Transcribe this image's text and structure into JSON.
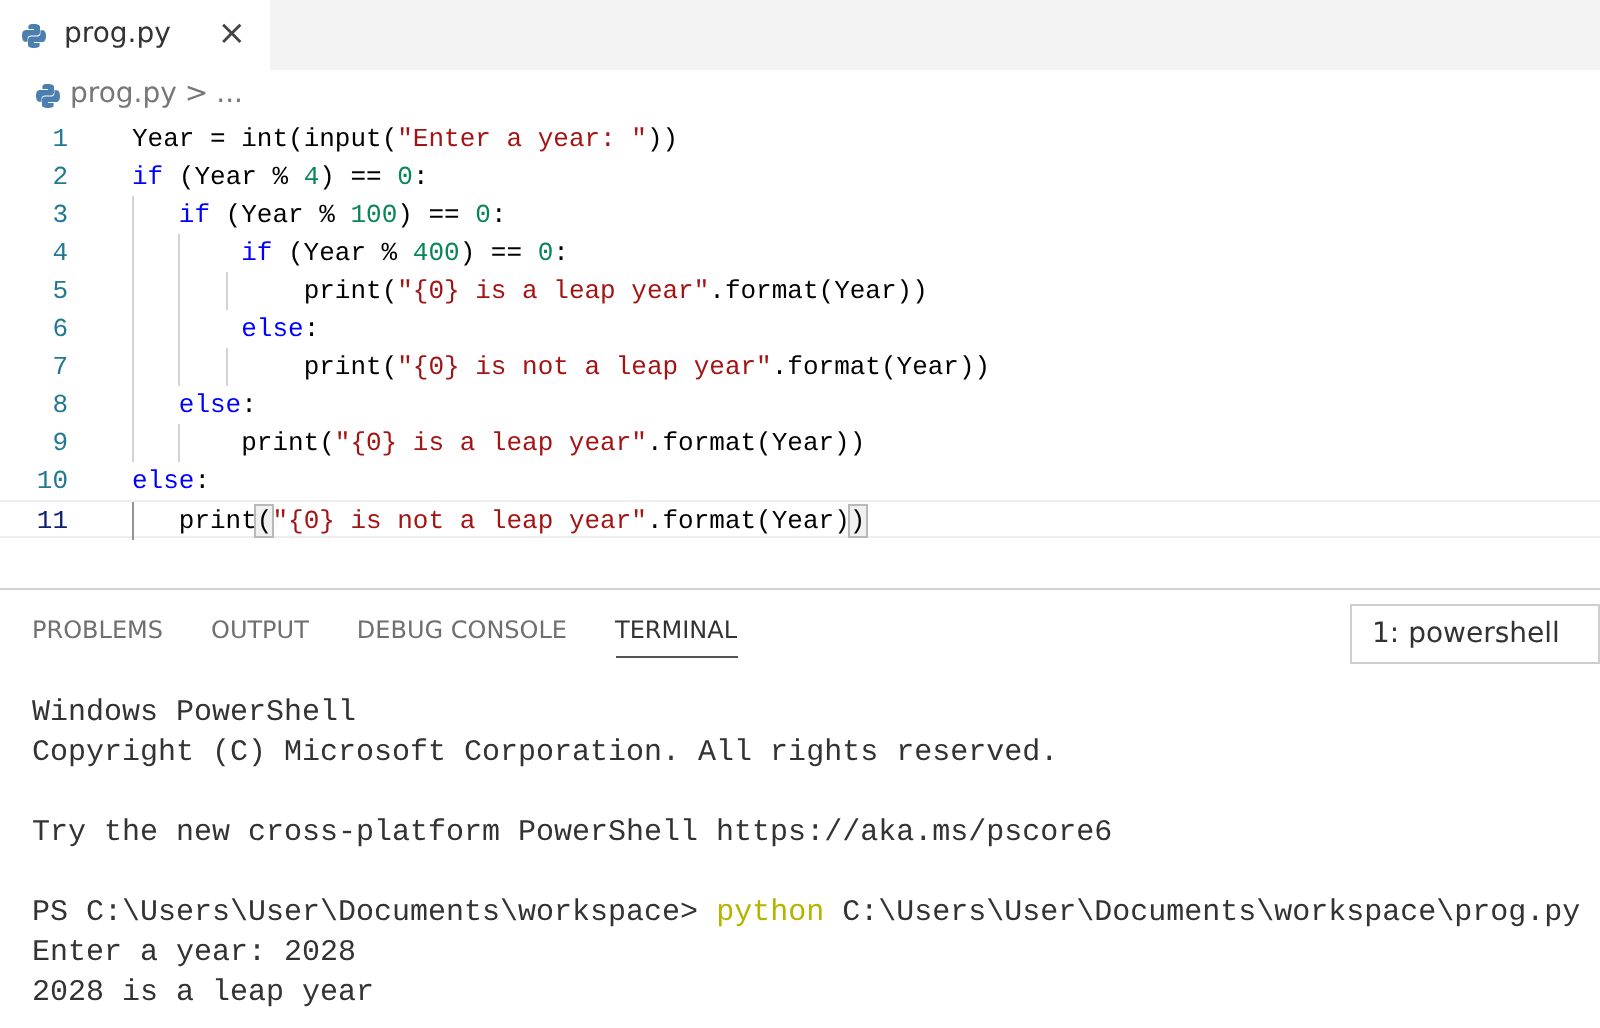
{
  "editor_tabs": [
    {
      "label": "prog.py",
      "selected": true,
      "close": "×"
    }
  ],
  "breadcrumb": {
    "file": "prog.py",
    "separator": ">",
    "more": "..."
  },
  "code_lines": [
    {
      "number": "1",
      "current": false,
      "tokens": [
        {
          "kind": "plain",
          "text": "Year = int(input("
        },
        {
          "kind": "string",
          "text": "\"Enter a year: \""
        },
        {
          "kind": "plain",
          "text": "))"
        }
      ]
    },
    {
      "number": "2",
      "current": false,
      "tokens": [
        {
          "kind": "keyword",
          "text": "if"
        },
        {
          "kind": "plain",
          "text": " (Year % "
        },
        {
          "kind": "number",
          "text": "4"
        },
        {
          "kind": "plain",
          "text": ") == "
        },
        {
          "kind": "number",
          "text": "0"
        },
        {
          "kind": "plain",
          "text": ":"
        }
      ],
      "children": [
        {
          "number": "3",
          "current": false,
          "tokens": [
            {
              "kind": "keyword",
              "text": "if"
            },
            {
              "kind": "plain",
              "text": " (Year % "
            },
            {
              "kind": "number",
              "text": "100"
            },
            {
              "kind": "plain",
              "text": ") == "
            },
            {
              "kind": "number",
              "text": "0"
            },
            {
              "kind": "plain",
              "text": ":"
            }
          ],
          "children": [
            {
              "number": "4",
              "current": false,
              "tokens": [
                {
                  "kind": "keyword",
                  "text": "if"
                },
                {
                  "kind": "plain",
                  "text": " (Year % "
                },
                {
                  "kind": "number",
                  "text": "400"
                },
                {
                  "kind": "plain",
                  "text": ") == "
                },
                {
                  "kind": "number",
                  "text": "0"
                },
                {
                  "kind": "plain",
                  "text": ":"
                }
              ],
              "children": [
                {
                  "number": "5",
                  "current": false,
                  "tokens": [
                    {
                      "kind": "plain",
                      "text": "print("
                    },
                    {
                      "kind": "string",
                      "text": "\"{0} is a leap year\""
                    },
                    {
                      "kind": "plain",
                      "text": ".format(Year))"
                    }
                  ]
                }
              ]
            },
            {
              "number": "6",
              "current": false,
              "tokens": [
                {
                  "kind": "keyword",
                  "text": "else"
                },
                {
                  "kind": "plain",
                  "text": ":"
                }
              ],
              "children": [
                {
                  "number": "7",
                  "current": false,
                  "tokens": [
                    {
                      "kind": "plain",
                      "text": "print("
                    },
                    {
                      "kind": "string",
                      "text": "\"{0} is not a leap year\""
                    },
                    {
                      "kind": "plain",
                      "text": ".format(Year))"
                    }
                  ]
                }
              ]
            }
          ]
        },
        {
          "number": "8",
          "current": false,
          "tokens": [
            {
              "kind": "keyword",
              "text": "else"
            },
            {
              "kind": "plain",
              "text": ":"
            }
          ],
          "children": [
            {
              "number": "9",
              "current": false,
              "tokens": [
                {
                  "kind": "plain",
                  "text": "print("
                },
                {
                  "kind": "string",
                  "text": "\"{0} is a leap year\""
                },
                {
                  "kind": "plain",
                  "text": ".format(Year))"
                }
              ]
            }
          ]
        }
      ]
    },
    {
      "number": "10",
      "current": false,
      "tokens": [
        {
          "kind": "keyword",
          "text": "else"
        },
        {
          "kind": "plain",
          "text": ":"
        }
      ],
      "children": [
        {
          "number": "11",
          "current": true,
          "tokens": [
            {
              "kind": "plain",
              "text": "print"
            },
            {
              "kind": "bracket",
              "text": "("
            },
            {
              "kind": "string",
              "text": "\"{0} is not a leap year\""
            },
            {
              "kind": "plain",
              "text": ".format(Year)"
            },
            {
              "kind": "bracket",
              "text": ")"
            }
          ]
        }
      ]
    }
  ],
  "panel_tabs": [
    {
      "label": "PROBLEMS",
      "selected": false
    },
    {
      "label": "OUTPUT",
      "selected": false
    },
    {
      "label": "DEBUG CONSOLE",
      "selected": false
    },
    {
      "label": "TERMINAL",
      "selected": true
    }
  ],
  "terminal_select": {
    "value": "1: powershell"
  },
  "terminal_lines": [
    {
      "spaced": false,
      "segments": [
        {
          "kind": "output",
          "text": "Windows PowerShell"
        }
      ]
    },
    {
      "spaced": false,
      "segments": [
        {
          "kind": "output",
          "text": "Copyright (C) Microsoft Corporation. All rights reserved."
        }
      ]
    },
    {
      "spaced": true,
      "segments": [
        {
          "kind": "output",
          "text": "Try the new cross-platform PowerShell https://aka.ms/pscore6"
        }
      ]
    },
    {
      "spaced": true,
      "segments": [
        {
          "kind": "output",
          "text": "PS C:\\Users\\User\\Documents\\workspace> "
        },
        {
          "kind": "command",
          "text": "python"
        },
        {
          "kind": "output",
          "text": " C:\\Users\\User\\Documents\\workspace\\prog.py"
        }
      ]
    },
    {
      "spaced": false,
      "segments": [
        {
          "kind": "output",
          "text": "Enter a year: 2028"
        }
      ]
    },
    {
      "spaced": false,
      "segments": [
        {
          "kind": "output",
          "text": "2028 is a leap year"
        }
      ]
    }
  ]
}
